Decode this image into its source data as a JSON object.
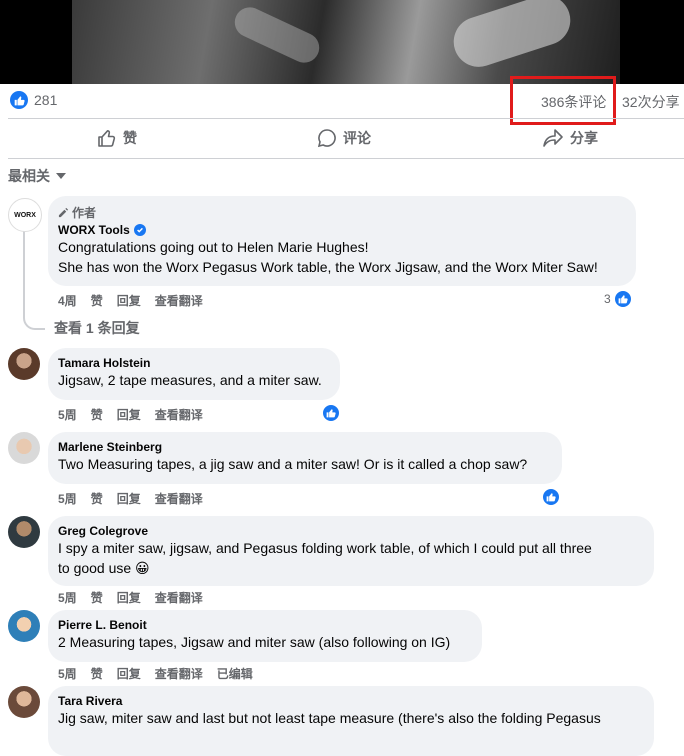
{
  "post": {
    "like_count": "281",
    "comment_count": "386条评论",
    "share_count": "32次分享",
    "actions": {
      "like": "赞",
      "comment": "评论",
      "share": "分享"
    },
    "sort_label": "最相关"
  },
  "comments": [
    {
      "author_tag": "作者",
      "name": "WORX Tools",
      "avatar_text": "WORX",
      "lines": [
        "Congratulations going out to Helen Marie Hughes!",
        "She has won the Worx Pegasus Work table, the Worx Jigsaw, and the Worx Miter Saw!"
      ],
      "time": "4周",
      "like": "赞",
      "reply": "回复",
      "translate": "查看翻译",
      "reaction_count": "3",
      "view_replies": "查看 1 条回复"
    },
    {
      "name": "Tamara Holstein",
      "lines": [
        "Jigsaw, 2 tape measures, and a miter saw."
      ],
      "time": "5周",
      "like": "赞",
      "reply": "回复",
      "translate": "查看翻译"
    },
    {
      "name": "Marlene Steinberg",
      "lines": [
        "Two Measuring tapes, a jig saw and a miter saw! Or is it called a chop saw?"
      ],
      "time": "5周",
      "like": "赞",
      "reply": "回复",
      "translate": "查看翻译"
    },
    {
      "name": "Greg Colegrove",
      "lines": [
        "I spy a miter saw, jigsaw, and Pegasus folding work table, of which I could put all three",
        "to good use 😀"
      ],
      "time": "5周",
      "like": "赞",
      "reply": "回复",
      "translate": "查看翻译"
    },
    {
      "name": "Pierre L. Benoit",
      "lines": [
        "2 Measuring tapes, Jigsaw and miter saw (also following on IG)"
      ],
      "time": "5周",
      "like": "赞",
      "reply": "回复",
      "translate": "查看翻译",
      "edited": "已编辑"
    },
    {
      "name": "Tara Rivera",
      "lines": [
        "Jig saw, miter saw and last but not least tape measure (there's also the folding Pegasus"
      ]
    }
  ],
  "colors": {
    "accent": "#1877f2",
    "highlight": "#e01b1b",
    "bubble": "#f0f2f5"
  }
}
